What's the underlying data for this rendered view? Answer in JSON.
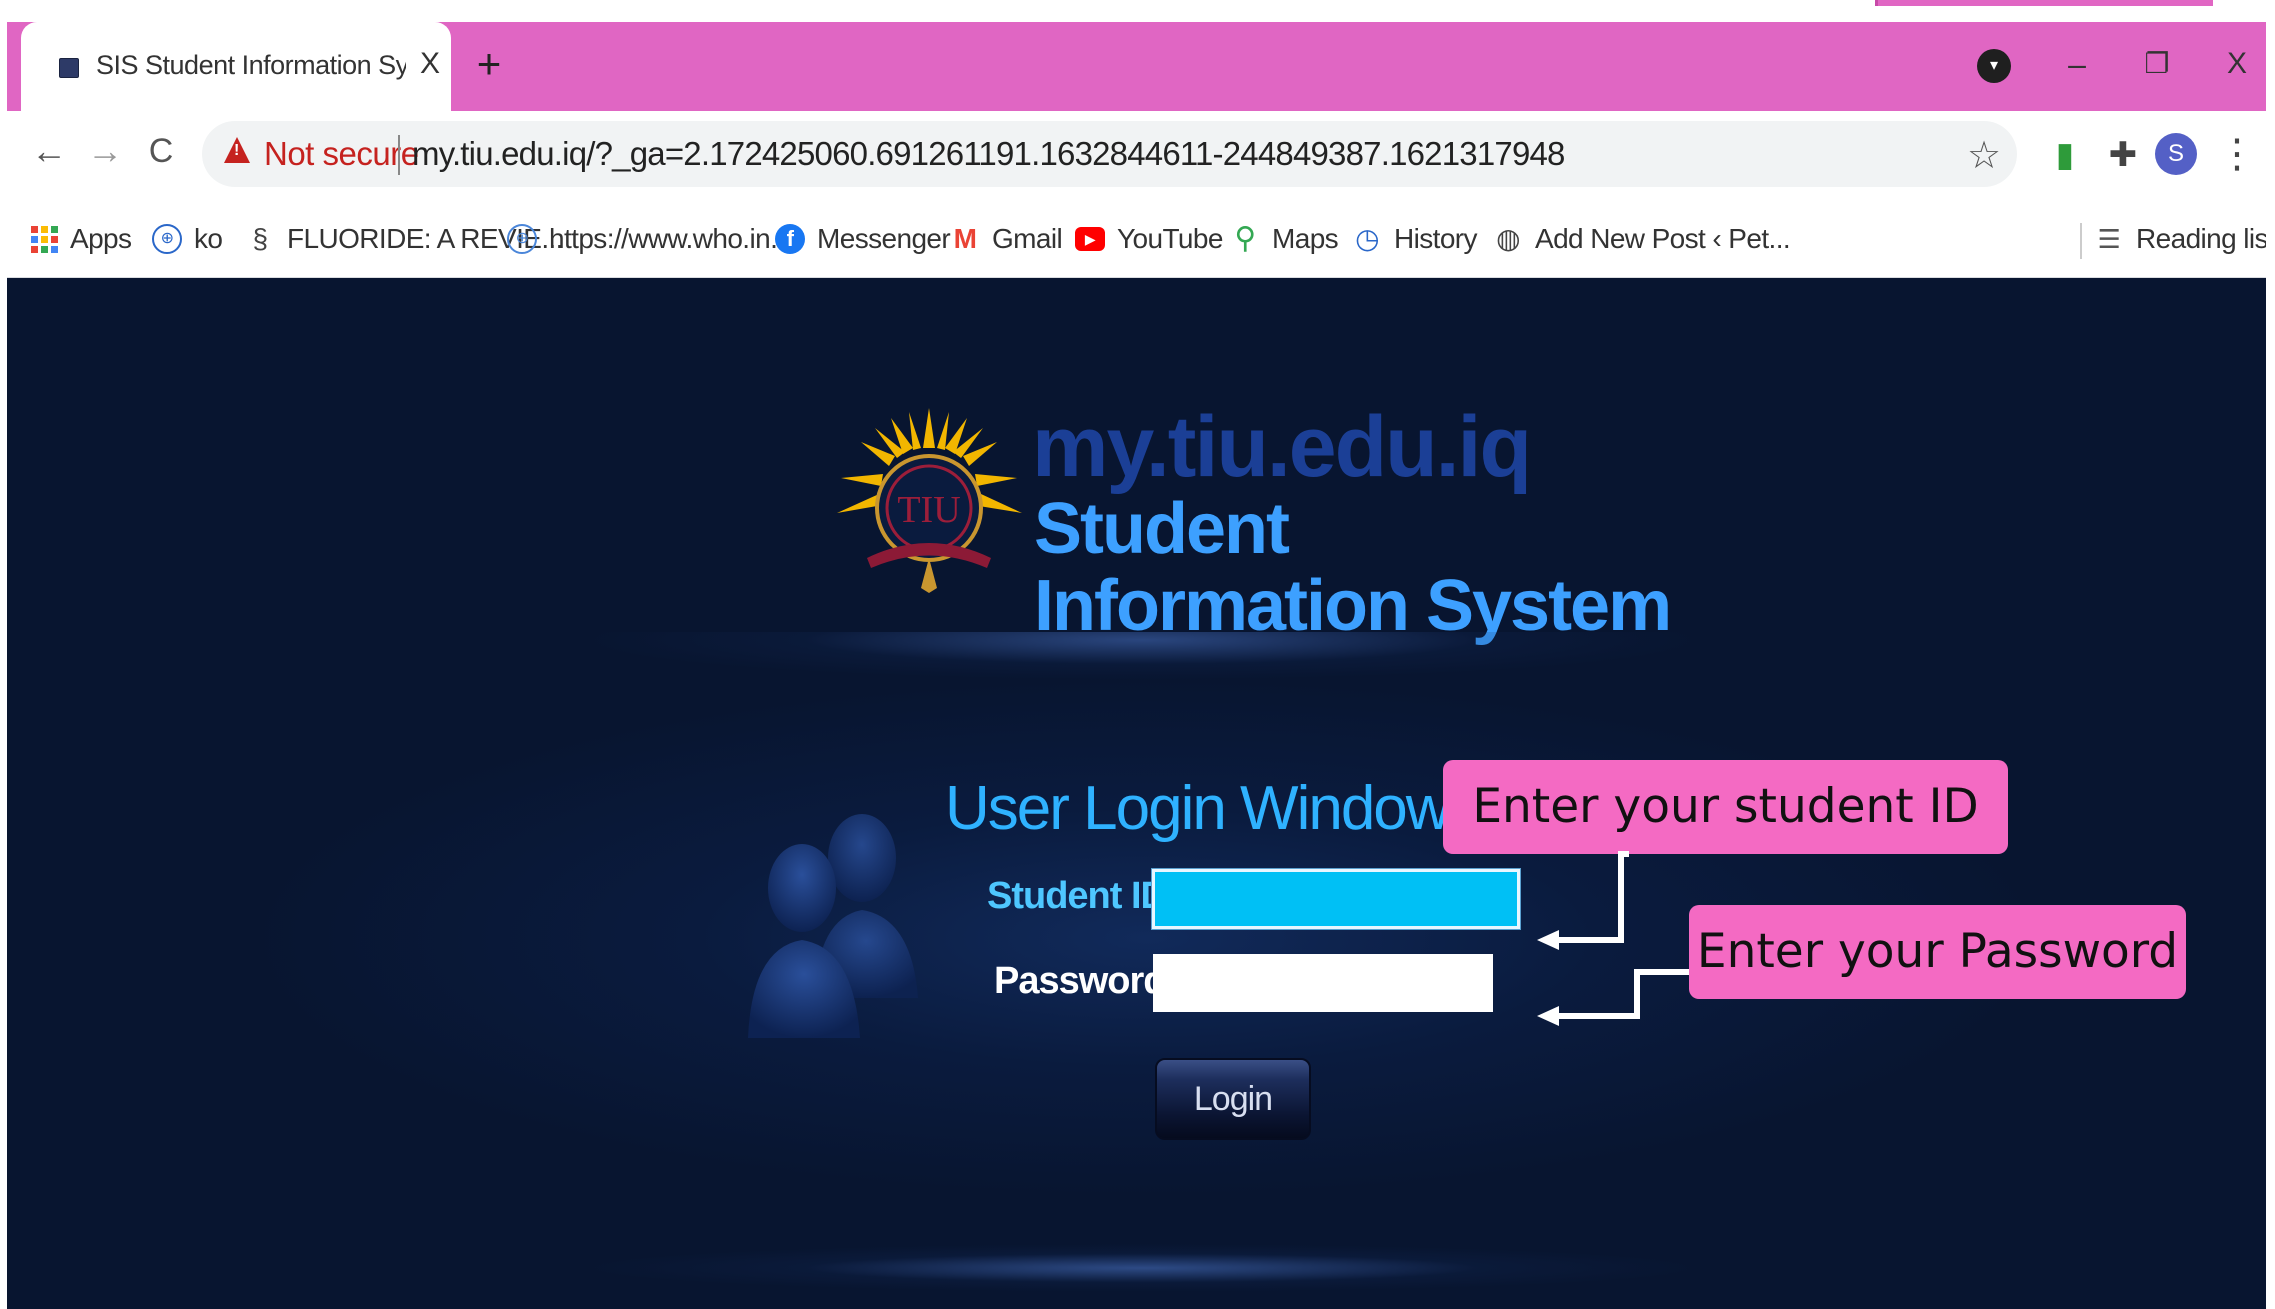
{
  "browser": {
    "tab": {
      "title": "SIS Student Information System -",
      "close_glyph": "X"
    },
    "new_tab_glyph": "+",
    "window_controls": {
      "minimize": "–",
      "restore": "❐",
      "close": "X"
    },
    "toolbar": {
      "back_glyph": "←",
      "forward_glyph": "→",
      "reload_glyph": "C",
      "security_label": "Not secure",
      "url": "my.tiu.edu.iq/?_ga=2.172425060.691261191.1632844611-244849387.1621317948",
      "profile_initial": "S"
    },
    "bookmarks": [
      {
        "label": "Apps",
        "icon": "apps-grid-icon"
      },
      {
        "label": "ko",
        "icon": "who-icon"
      },
      {
        "label": "FLUORIDE: A REVIE...",
        "icon": "dna-icon"
      },
      {
        "label": "https://www.who.in...",
        "icon": "who-icon"
      },
      {
        "label": "Messenger",
        "icon": "facebook-icon"
      },
      {
        "label": "Gmail",
        "icon": "gmail-icon"
      },
      {
        "label": "YouTube",
        "icon": "youtube-icon"
      },
      {
        "label": "Maps",
        "icon": "maps-icon"
      },
      {
        "label": "History",
        "icon": "history-icon"
      },
      {
        "label": "Add New Post ‹ Pet...",
        "icon": "globe-icon"
      }
    ],
    "reading_list": "Reading list"
  },
  "page": {
    "logo": {
      "emblem_text": "TIU",
      "url_text": "my.tiu.edu.iq",
      "line1": "Student",
      "line2": "Information System"
    },
    "login": {
      "title": "User Login Window",
      "student_id_label": "Student ID:",
      "password_label": "Password:",
      "student_id_value": "",
      "password_value": "",
      "button": "Login"
    },
    "callouts": {
      "student_id": "Enter your student ID",
      "password": "Enter your Password"
    }
  },
  "colors": {
    "tabstrip": "#e066c3",
    "page_bg": "#081530",
    "login_title": "#2fb2ff",
    "student_id_field": "#00c0f5",
    "callout": "#f46ac3"
  }
}
